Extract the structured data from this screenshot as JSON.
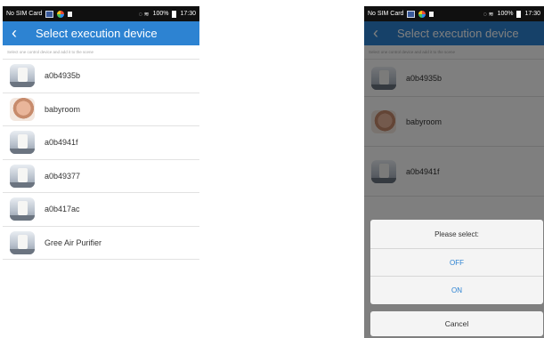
{
  "status_bar": {
    "carrier": "No SIM Card",
    "battery": "100%",
    "time": "17:30"
  },
  "header": {
    "title": "Select execution device"
  },
  "hint": "Select one control device and add it to the scene",
  "devices": [
    {
      "name": "a0b4935b",
      "icon": "device-icon"
    },
    {
      "name": "babyroom",
      "icon": "baby-photo-icon"
    },
    {
      "name": "a0b4941f",
      "icon": "device-icon"
    },
    {
      "name": "a0b49377",
      "icon": "device-icon"
    },
    {
      "name": "a0b417ac",
      "icon": "device-icon"
    },
    {
      "name": "Gree Air Purifier",
      "icon": "device-icon"
    }
  ],
  "dialog": {
    "title": "Please select:",
    "options": [
      "OFF",
      "ON"
    ],
    "cancel": "Cancel"
  },
  "colors": {
    "accent": "#2d83d2"
  }
}
